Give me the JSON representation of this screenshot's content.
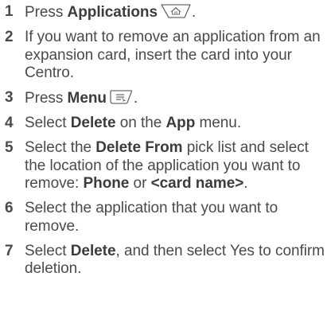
{
  "steps": [
    {
      "num": "1",
      "parts": {
        "a": "Press ",
        "b": "Applications",
        "c": "."
      },
      "icon": "applications-key-icon"
    },
    {
      "num": "2",
      "text": "If you want to remove an application from an expansion card, insert the card into your Centro."
    },
    {
      "num": "3",
      "parts": {
        "a": "Press ",
        "b": "Menu",
        "c": "."
      },
      "icon": "menu-key-icon"
    },
    {
      "num": "4",
      "parts": {
        "a": "Select ",
        "b": "Delete",
        "c": " on the ",
        "d": "App",
        "e": " menu."
      }
    },
    {
      "num": "5",
      "parts": {
        "a": "Select the ",
        "b": "Delete From",
        "c": " pick list and select the location of the application you want to remove: ",
        "d": "Phone",
        "e": " or ",
        "f": "<card name>",
        "g": "."
      }
    },
    {
      "num": "6",
      "text": "Select the application that you want to remove."
    },
    {
      "num": "7",
      "parts": {
        "a": "Select ",
        "b": "Delete",
        "c": ", and then select Yes to confirm deletion."
      }
    }
  ]
}
